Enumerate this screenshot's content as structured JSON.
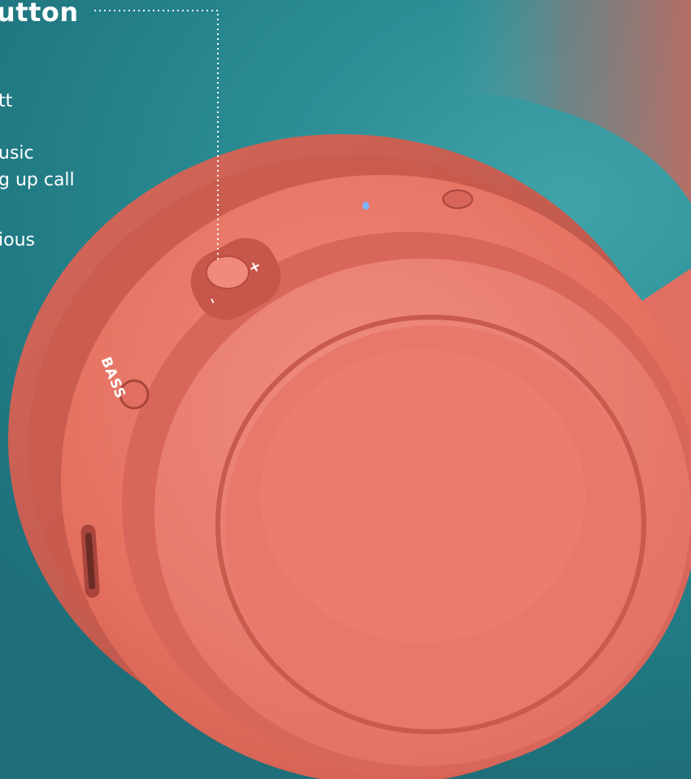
{
  "callout": {
    "title": "utton",
    "lines": [
      "tt",
      "usic",
      "g up call",
      "ious"
    ]
  },
  "labels": {
    "bass": "BASS",
    "plus": "+",
    "minus": "–"
  },
  "colors": {
    "background": "#2c8e95",
    "headphone": "#e8766a",
    "cushion": "#c45a50",
    "text": "#ffffff"
  },
  "icons": [
    "power-icon",
    "led-indicator-icon"
  ]
}
